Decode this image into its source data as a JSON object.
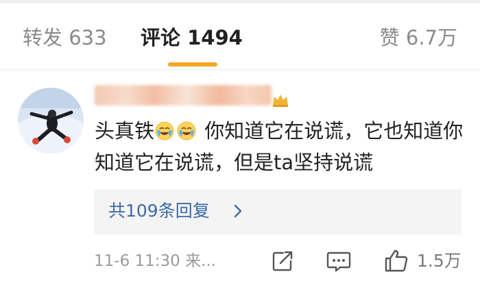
{
  "tabs": {
    "repost": "转发 633",
    "comment": "评论 1494",
    "like": "赞 6.7万"
  },
  "comment": {
    "text_before_emoji": "头真铁",
    "emojis": [
      "crying-laughing-emoji",
      "crying-laughing-emoji"
    ],
    "text_after_emoji": " 你知道它在说谎，它也知道你知道它在说谎，但是ta坚持说谎",
    "replies_label": "共109条回复",
    "time_source": "11-6 11:30 来...",
    "like_count": "1.5万"
  },
  "colors": {
    "accent": "#f5a623",
    "link": "#3a6aa6"
  }
}
